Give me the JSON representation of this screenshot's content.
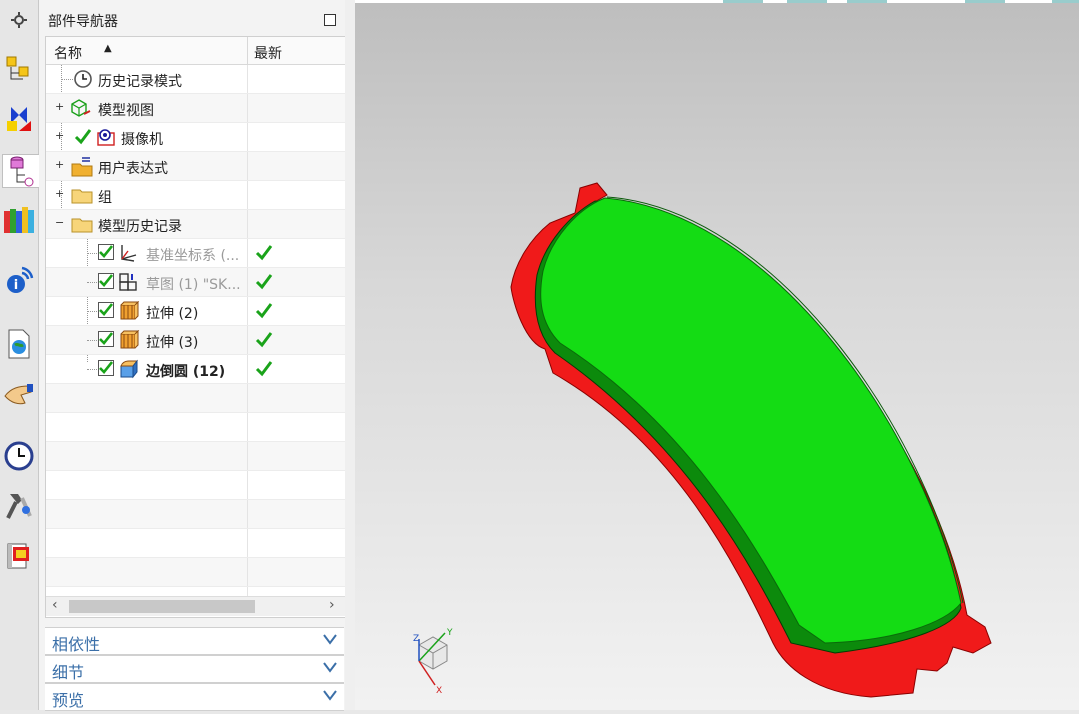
{
  "resource_bar": {
    "items": [
      {
        "name": "settings-icon"
      },
      {
        "name": "assembly-navigator-icon"
      },
      {
        "name": "constraint-navigator-icon"
      },
      {
        "name": "part-navigator-icon"
      },
      {
        "name": "reuse-library-icon"
      },
      {
        "name": "info-feed-icon"
      },
      {
        "name": "web-browser-icon"
      },
      {
        "name": "history-palette-icon"
      },
      {
        "name": "clock-history-icon"
      },
      {
        "name": "process-studio-icon"
      },
      {
        "name": "roles-icon"
      }
    ]
  },
  "navigator": {
    "title": "部件导航器",
    "columns": {
      "name": "名称",
      "latest": "最新"
    },
    "rows": [
      {
        "label": "历史记录模式"
      },
      {
        "label": "模型视图"
      },
      {
        "label": "摄像机"
      },
      {
        "label": "用户表达式"
      },
      {
        "label": "组"
      },
      {
        "label": "模型历史记录"
      },
      {
        "label": "基准坐标系 (..."
      },
      {
        "label": "草图 (1) \"SK..."
      },
      {
        "label": "拉伸 (2)"
      },
      {
        "label": "拉伸 (3)"
      },
      {
        "label": "边倒圆 (12)"
      }
    ]
  },
  "panels": {
    "dependencies": "相依性",
    "details": "细节",
    "preview": "预览"
  },
  "triad": {
    "x": "X",
    "y": "Y",
    "z": "Z"
  },
  "colors": {
    "accent": "#3b6fa8",
    "check_green": "#1aa31a",
    "part_green": "#14dc14",
    "part_red": "#f01a1a"
  }
}
